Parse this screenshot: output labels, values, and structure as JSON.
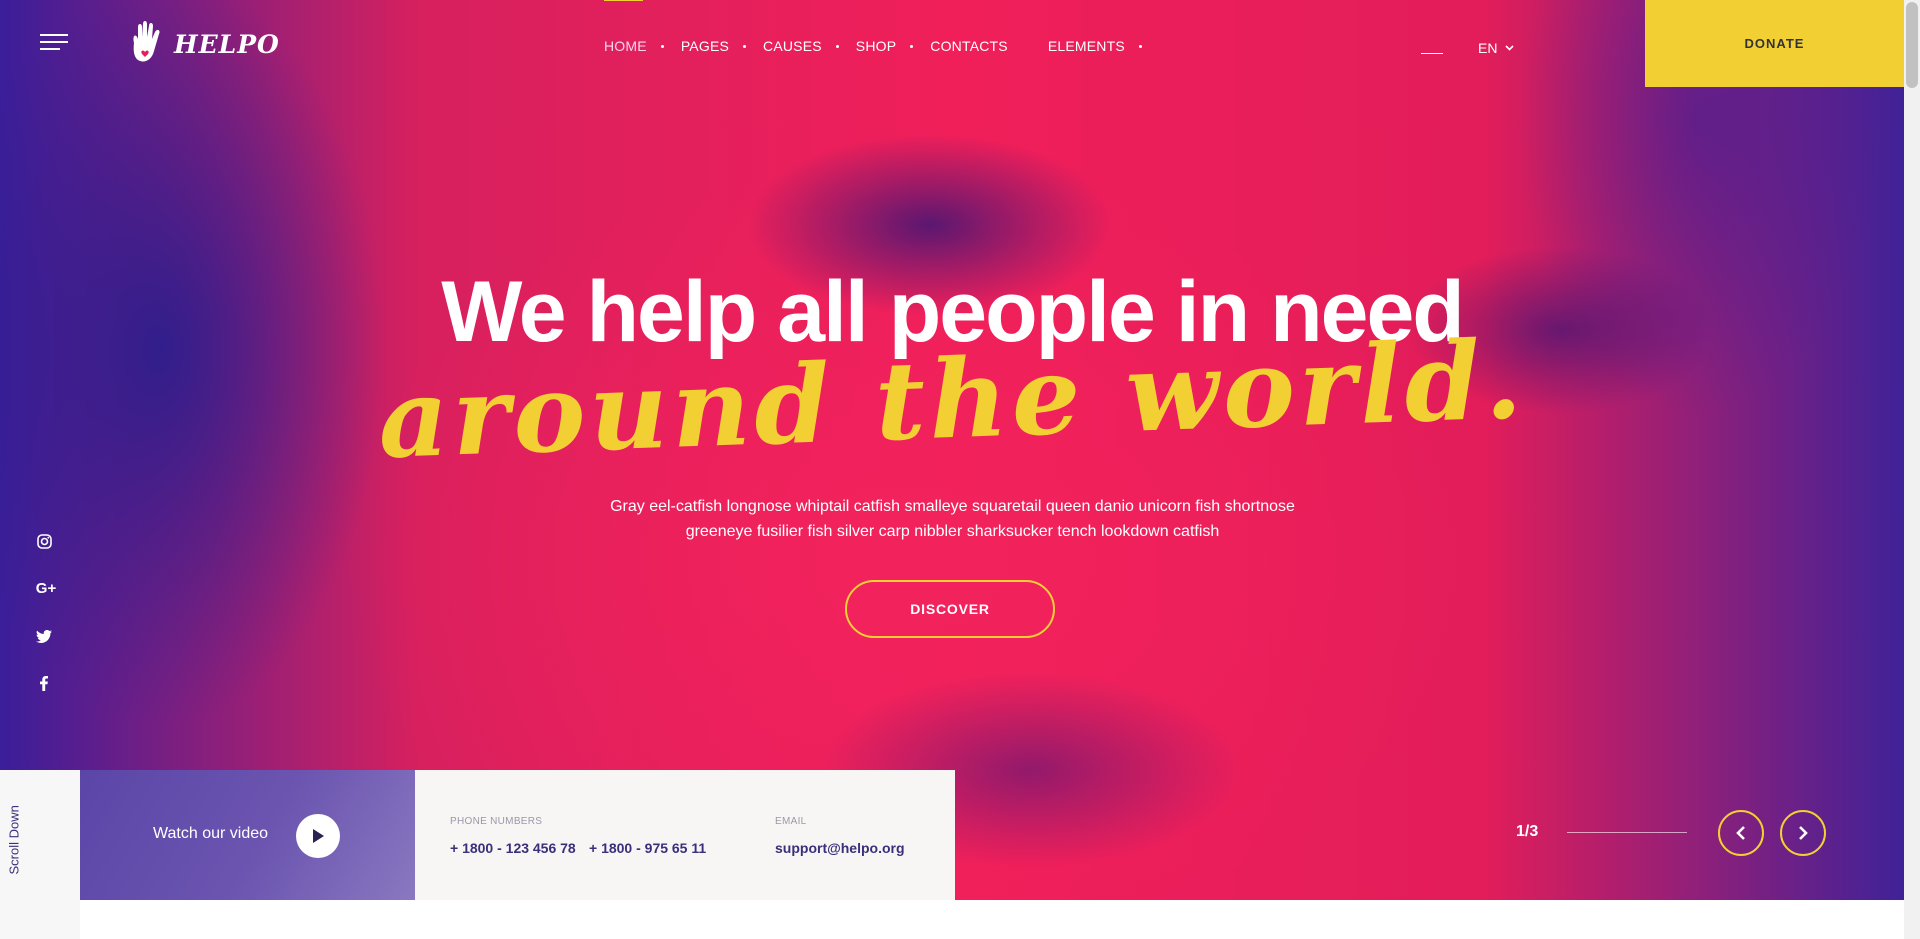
{
  "brand": {
    "name": "HELPO"
  },
  "nav": {
    "items": [
      "HOME",
      "PAGES",
      "CAUSES",
      "SHOP",
      "CONTACTS",
      "ELEMENTS"
    ],
    "active": "HOME"
  },
  "header": {
    "language": "EN",
    "donate_label": "DONATE"
  },
  "hero": {
    "headline": "We help all people in need",
    "script": "around the world.",
    "description_line1": "Gray eel-catfish longnose whiptail catfish smalleye squaretail queen danio unicorn fish shortnose",
    "description_line2": "greeneye fusilier fish silver carp nibbler sharksucker tench lookdown catfish",
    "cta_label": "DISCOVER"
  },
  "social": [
    "instagram-icon",
    "google-plus-icon",
    "twitter-icon",
    "facebook-icon"
  ],
  "bottom": {
    "scroll_label": "Scroll Down",
    "video_label": "Watch our video",
    "phone_label": "PHONE NUMBERS",
    "phone_1": "+ 1800 - 123 456 78",
    "phone_2": "+ 1800 - 975 65 11",
    "email_label": "EMAIL",
    "email": "support@helpo.org"
  },
  "slider": {
    "counter": "1/3"
  },
  "colors": {
    "accent": "#f2d034",
    "hero_pink": "#f01f5a",
    "hero_violet": "#3a1e9a",
    "text_dark": "#3a2f7a"
  }
}
